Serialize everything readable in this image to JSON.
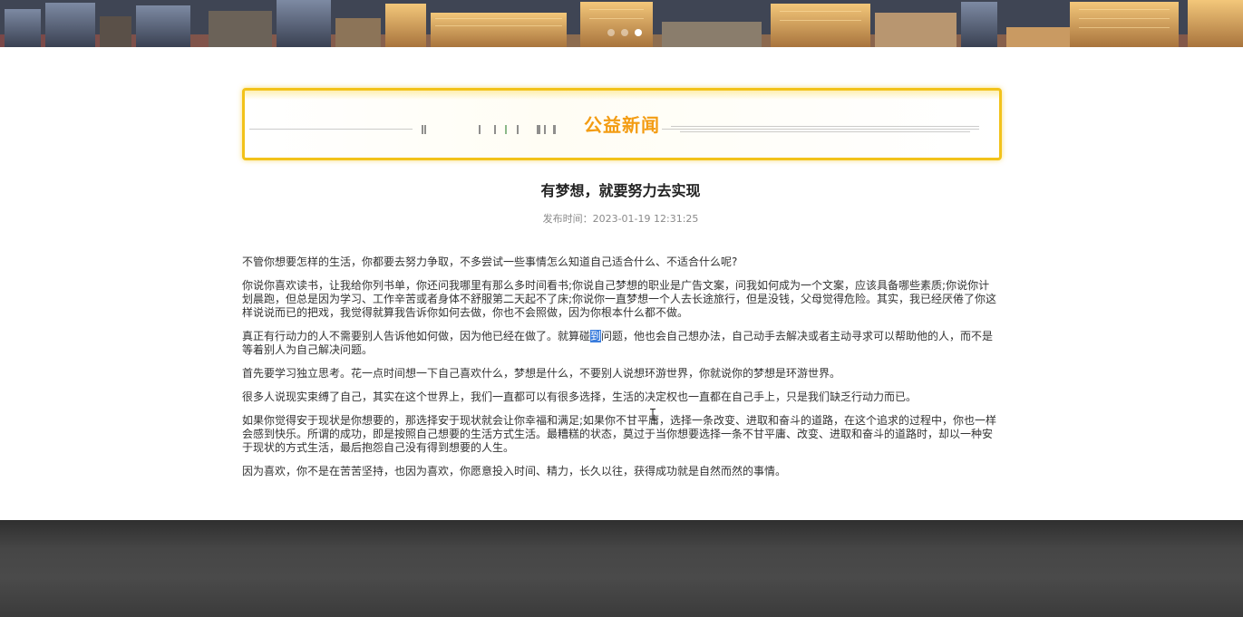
{
  "hero": {
    "slide_count": 3,
    "active_slide": 3
  },
  "section": {
    "title": "公益新闻",
    "accent_color": "#f39c12",
    "border_color": "#f2c21a"
  },
  "article": {
    "title": "有梦想，就要努力去实现",
    "meta": "发布时间：2023-01-19 12:31:25",
    "paragraphs": [
      "不管你想要怎样的生活，你都要去努力争取，不多尝试一些事情怎么知道自己适合什么、不适合什么呢?",
      "你说你喜欢读书，让我给你列书单，你还问我哪里有那么多时间看书;你说自己梦想的职业是广告文案，问我如何成为一个文案，应该具备哪些素质;你说你计划晨跑，但总是因为学习、工作辛苦或者身体不舒服第二天起不了床;你说你一直梦想一个人去长途旅行，但是没钱，父母觉得危险。其实，我已经厌倦了你这样说说而已的把戏，我觉得就算我告诉你如何去做，你也不会照做，因为你根本什么都不做。",
      {
        "before": "真正有行动力的人不需要别人告诉他如何做，因为他已经在做了。就算碰",
        "highlight": "到",
        "after": "问题，他也会自己想办法，自己动手去解决或者主动寻求可以帮助他的人，而不是等着别人为自己解决问题。"
      },
      "首先要学习独立思考。花一点时间想一下自己喜欢什么，梦想是什么，不要别人说想环游世界，你就说你的梦想是环游世界。",
      "很多人说现实束缚了自己，其实在这个世界上，我们一直都可以有很多选择，生活的决定权也一直都在自己手上，只是我们缺乏行动力而已。",
      "如果你觉得安于现状是你想要的，那选择安于现状就会让你幸福和满足;如果你不甘平庸，选择一条改变、进取和奋斗的道路，在这个追求的过程中，你也一样会感到快乐。所谓的成功，即是按照自己想要的生活方式生活。最糟糕的状态，莫过于当你想要选择一条不甘平庸、改变、进取和奋斗的道路时，却以一种安于现状的方式生活，最后抱怨自己没有得到想要的人生。",
      "因为喜欢，你不是在苦苦坚持，也因为喜欢，你愿意投入时间、精力，长久以往，获得成功就是自然而然的事情。"
    ]
  }
}
